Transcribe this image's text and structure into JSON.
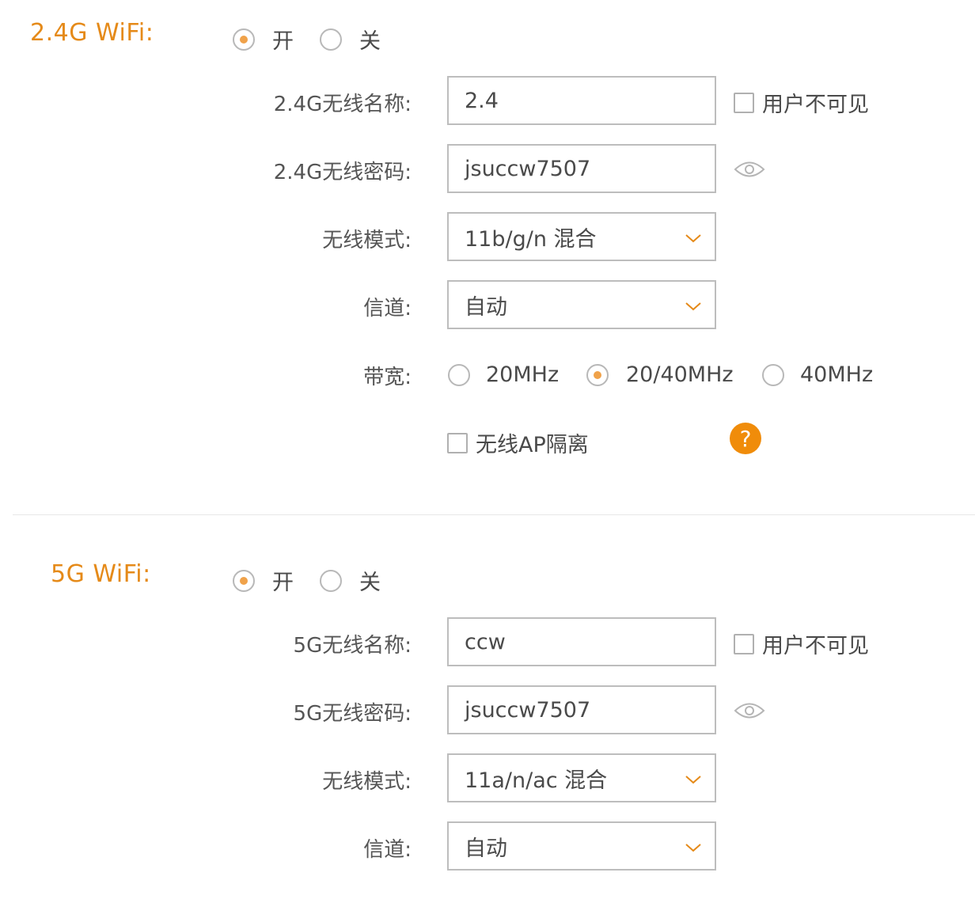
{
  "wifi24": {
    "title": "2.4G WiFi:",
    "on_label": "开",
    "off_label": "关",
    "ssid_label": "2.4G无线名称:",
    "ssid_value": "2.4",
    "hidden_label": "用户不可见",
    "password_label": "2.4G无线密码:",
    "password_value": "jsuccw7507",
    "mode_label": "无线模式:",
    "mode_value": "11b/g/n 混合",
    "channel_label": "信道:",
    "channel_value": "自动",
    "bandwidth_label": "带宽:",
    "bandwidth_options": [
      "20MHz",
      "20/40MHz",
      "40MHz"
    ],
    "bandwidth_selected": "20/40MHz",
    "ap_isolation_label": "无线AP隔离",
    "help_glyph": "?"
  },
  "wifi5": {
    "title": "5G WiFi:",
    "on_label": "开",
    "off_label": "关",
    "ssid_label": "5G无线名称:",
    "ssid_value": "ccw",
    "hidden_label": "用户不可见",
    "password_label": "5G无线密码:",
    "password_value": "jsuccw7507",
    "mode_label": "无线模式:",
    "mode_value": "11a/n/ac 混合",
    "channel_label": "信道:",
    "channel_value": "自动"
  },
  "colors": {
    "accent": "#e58a19",
    "radio_dot": "#f0a24a",
    "help_bg": "#f08c0a",
    "border": "#bdbdbd"
  },
  "icons": [
    "eye-icon",
    "chevron-down-icon",
    "question-icon"
  ]
}
